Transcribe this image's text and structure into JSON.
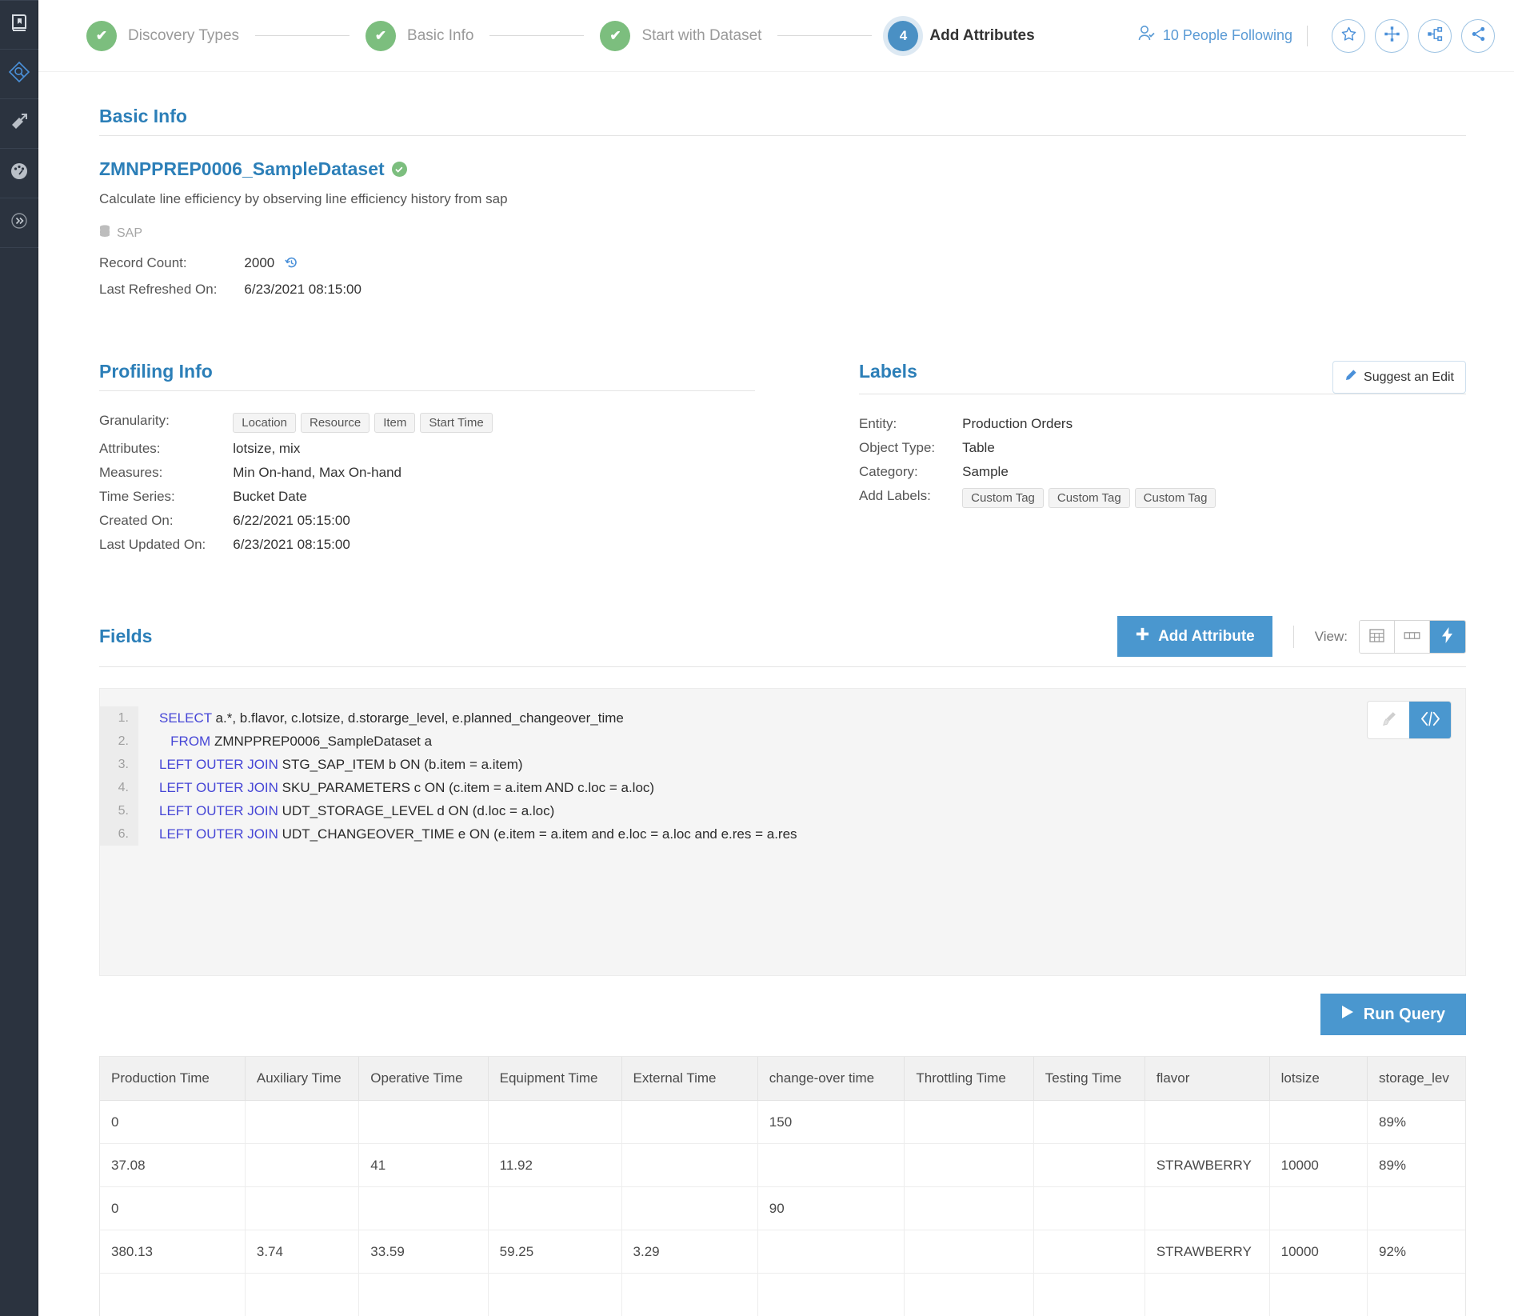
{
  "rail": {
    "items": [
      {
        "name": "app-logo",
        "icon": "book-logo-icon"
      },
      {
        "name": "discovery",
        "icon": "diamond-search-icon"
      },
      {
        "name": "library",
        "icon": "book-arrow-icon"
      },
      {
        "name": "dashboard",
        "icon": "gauge-icon"
      },
      {
        "name": "collapse",
        "icon": "chevron-double-right-icon"
      }
    ]
  },
  "stepper": {
    "steps": [
      {
        "label": "Discovery Types",
        "state": "done",
        "marker": "✔"
      },
      {
        "label": "Basic Info",
        "state": "done",
        "marker": "✔"
      },
      {
        "label": "Start with Dataset",
        "state": "done",
        "marker": "✔"
      },
      {
        "label": "Add Attributes",
        "state": "current",
        "marker": "4"
      }
    ],
    "following_text": "10 People Following",
    "actions": [
      {
        "name": "favorite-button",
        "icon": "star-icon"
      },
      {
        "name": "expand-button",
        "icon": "move-expand-icon"
      },
      {
        "name": "lineage-button",
        "icon": "hierarchy-icon"
      },
      {
        "name": "share-button",
        "icon": "share-icon"
      }
    ]
  },
  "basic_info": {
    "title": "Basic Info",
    "dataset_name": "ZMNPPREP0006_SampleDataset",
    "description": "Calculate line efficiency by observing line efficiency history from sap",
    "source": "SAP",
    "record_count_label": "Record Count:",
    "record_count_value": "2000",
    "last_refreshed_label": "Last Refreshed On:",
    "last_refreshed_value": "6/23/2021 08:15:00"
  },
  "profiling_info": {
    "title": "Profiling Info",
    "granularity_label": "Granularity:",
    "granularity_tags": [
      "Location",
      "Resource",
      "Item",
      "Start Time"
    ],
    "attributes_label": "Attributes:",
    "attributes_value": "lotsize, mix",
    "measures_label": "Measures:",
    "measures_value": "Min On-hand, Max On-hand",
    "time_series_label": "Time Series:",
    "time_series_value": "Bucket Date",
    "created_on_label": "Created On:",
    "created_on_value": "6/22/2021 05:15:00",
    "last_updated_label": "Last Updated On:",
    "last_updated_value": "6/23/2021 08:15:00"
  },
  "labels": {
    "title": "Labels",
    "suggest_edit": "Suggest an Edit",
    "entity_label": "Entity:",
    "entity_value": "Production Orders",
    "object_type_label": "Object Type:",
    "object_type_value": "Table",
    "category_label": "Category:",
    "category_value": "Sample",
    "add_labels_label": "Add Labels:",
    "custom_tags": [
      "Custom Tag",
      "Custom Tag",
      "Custom Tag"
    ]
  },
  "fields": {
    "title": "Fields",
    "add_attribute": "Add Attribute",
    "view_label": "View:",
    "view_options": [
      {
        "name": "grid-view",
        "icon": "grid-icon",
        "active": false
      },
      {
        "name": "column-view",
        "icon": "columns-icon",
        "active": false
      },
      {
        "name": "query-view",
        "icon": "lightning-icon",
        "active": true
      }
    ],
    "editor_tools": [
      {
        "name": "format-button",
        "icon": "brush-icon",
        "active": false
      },
      {
        "name": "code-button",
        "icon": "code-icon",
        "active": true
      }
    ],
    "run_query": "Run Query",
    "query_lines": [
      {
        "n": "1.",
        "kw": "SELECT",
        "rest": " a.*, b.flavor, c.lotsize, d.storarge_level, e.planned_changeover_time",
        "indent": ""
      },
      {
        "n": "2.",
        "kw": "FROM",
        "rest": " ZMNPPREP0006_SampleDataset a",
        "indent": "   "
      },
      {
        "n": "3.",
        "kw": "LEFT OUTER JOIN",
        "rest": " STG_SAP_ITEM b ON (b.item = a.item)",
        "indent": ""
      },
      {
        "n": "4.",
        "kw": "LEFT OUTER JOIN",
        "rest": " SKU_PARAMETERS c ON (c.item = a.item AND c.loc = a.loc)",
        "indent": ""
      },
      {
        "n": "5.",
        "kw": "LEFT OUTER JOIN",
        "rest": " UDT_STORAGE_LEVEL d ON (d.loc = a.loc)",
        "indent": ""
      },
      {
        "n": "6.",
        "kw": "LEFT OUTER JOIN",
        "rest": " UDT_CHANGEOVER_TIME e ON (e.item = a.item and e.loc = a.loc and e.res = a.res",
        "indent": ""
      }
    ]
  },
  "results": {
    "columns": [
      "Production  Time",
      "Auxiliary Time",
      "Operative Time",
      "Equipment Time",
      "External Time",
      "change-over time",
      "Throttling Time",
      "Testing Time",
      "flavor",
      "lotsize",
      "storage_lev"
    ],
    "rows": [
      [
        "0",
        "",
        "",
        "",
        "",
        "150",
        "",
        "",
        "",
        "",
        "89%"
      ],
      [
        "37.08",
        "",
        "41",
        "11.92",
        "",
        "",
        "",
        "",
        "STRAWBERRY",
        "10000",
        "89%"
      ],
      [
        "0",
        "",
        "",
        "",
        "",
        "90",
        "",
        "",
        "",
        "",
        ""
      ],
      [
        "380.13",
        "3.74",
        "33.59",
        "59.25",
        "3.29",
        "",
        "",
        "",
        "STRAWBERRY",
        "10000",
        "92%"
      ],
      [
        "",
        "",
        "",
        "",
        "",
        "",
        "",
        "",
        "",
        "",
        ""
      ]
    ]
  },
  "colors": {
    "accent": "#4a97cf",
    "heading": "#2c7fb8",
    "done": "#7cbe7e",
    "rail": "#2b333f"
  }
}
